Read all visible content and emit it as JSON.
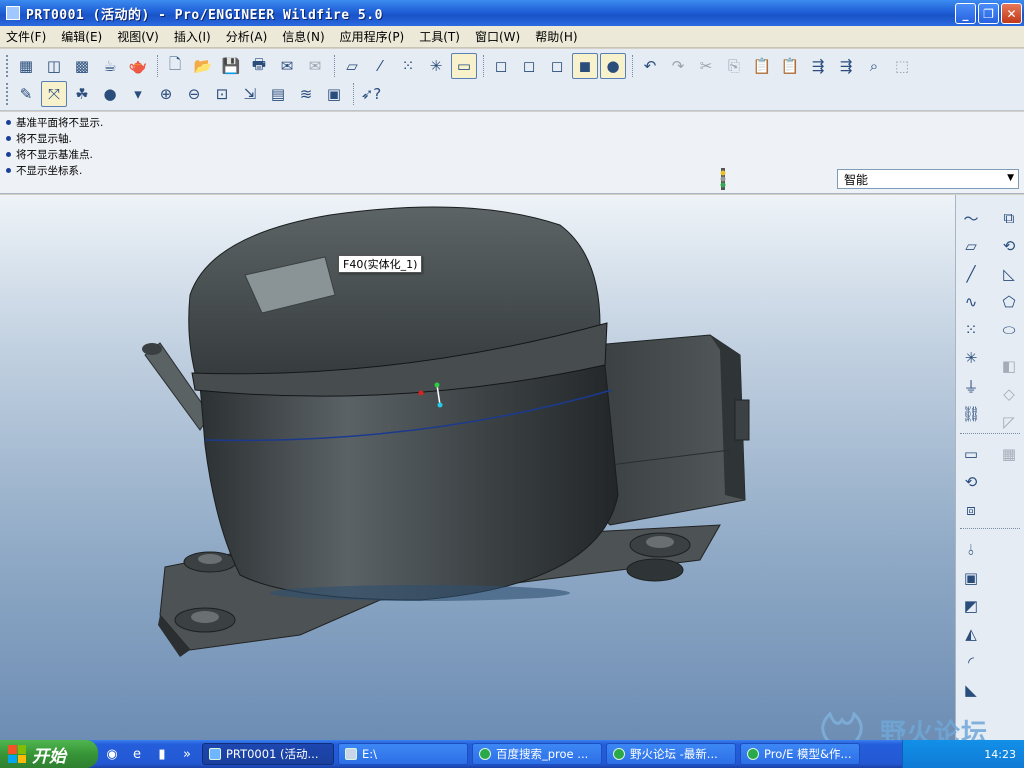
{
  "window": {
    "title": "PRT0001 (活动的) - Pro/ENGINEER Wildfire 5.0"
  },
  "menu": [
    "文件(F)",
    "编辑(E)",
    "视图(V)",
    "插入(I)",
    "分析(A)",
    "信息(N)",
    "应用程序(P)",
    "工具(T)",
    "窗口(W)",
    "帮助(H)"
  ],
  "messages": [
    "基准平面将不显示.",
    "将不显示轴.",
    "将不显示基准点.",
    "不显示坐标系."
  ],
  "filter": {
    "value": "智能"
  },
  "tooltip": "F40(实体化_1)",
  "watermark": {
    "text": "野火论坛"
  },
  "taskbar": {
    "start": "开始",
    "tasks": [
      "PRT0001 (活动...",
      "E:\\",
      "百度搜索_proe ...",
      "野火论坛 -最新...",
      "Pro/E 模型&作..."
    ],
    "clock": "14:23"
  },
  "colors": {
    "titlebar": "#1f5fd7",
    "model_body": "#3f4547",
    "viewport_top": "#eef3f8",
    "viewport_bottom": "#6d8db4"
  }
}
